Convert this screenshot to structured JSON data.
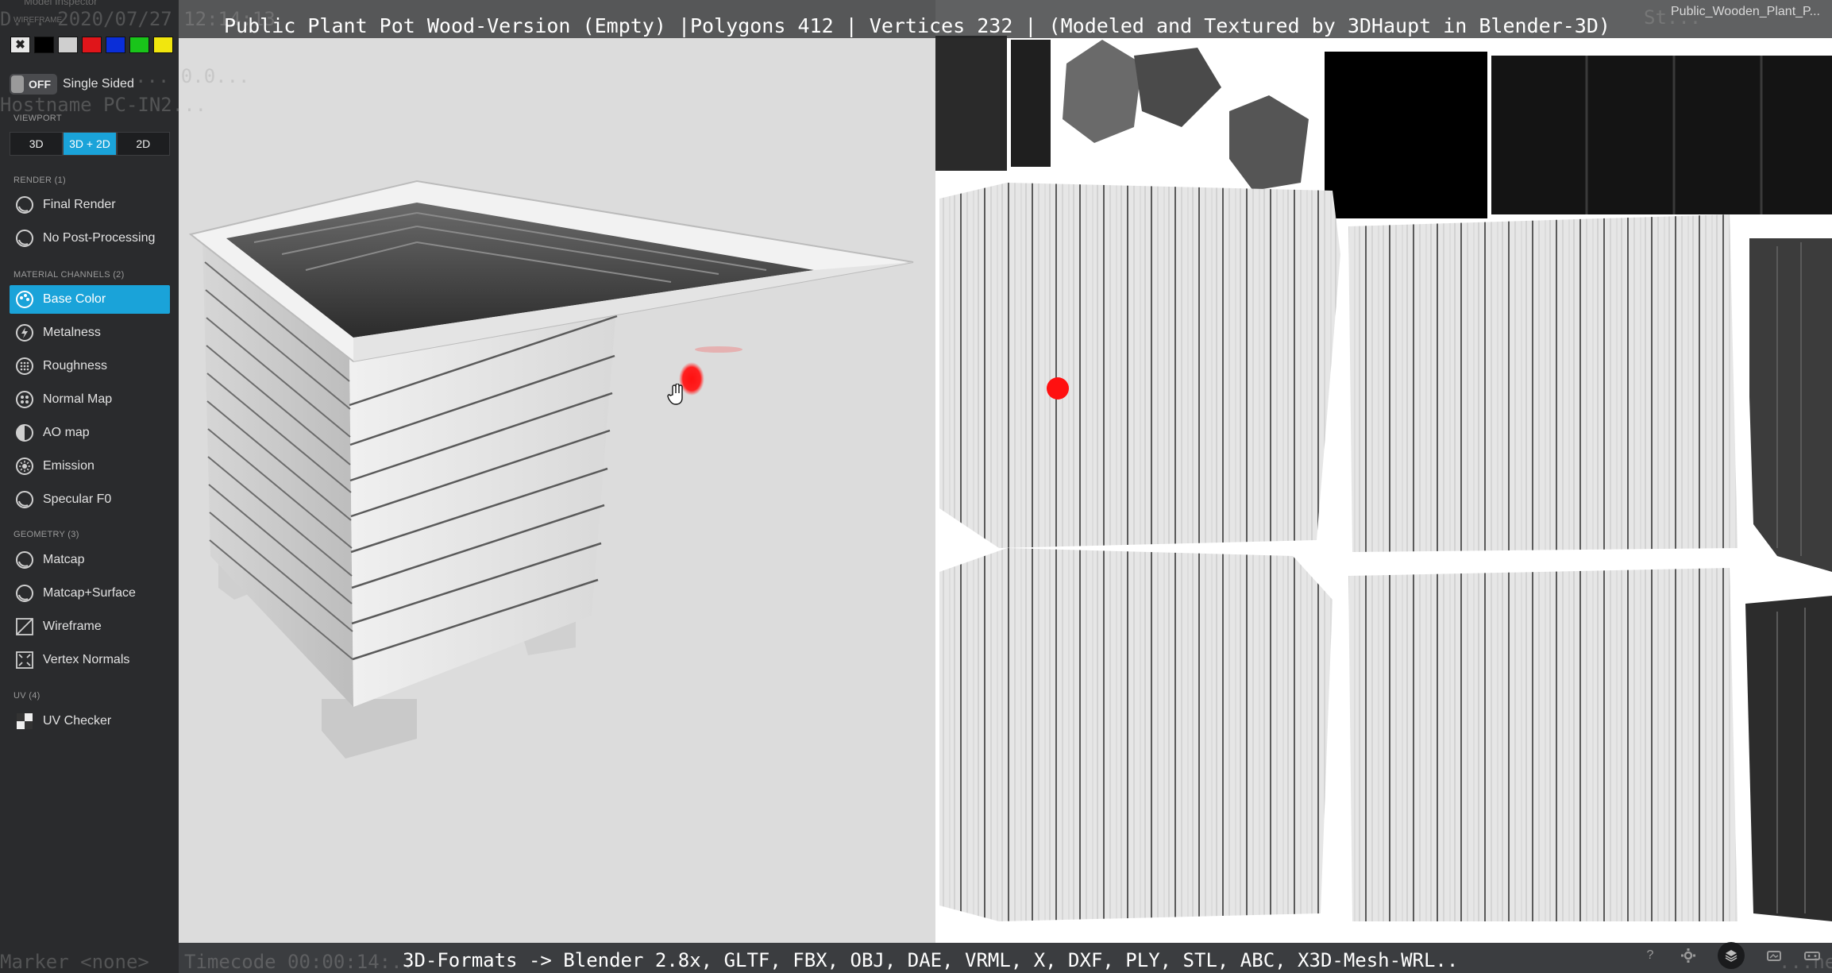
{
  "window": {
    "title": "Public Plant Pot Wood-Version (Empty) |Polygons 412 | Vertices 232 | (Modeled and Textured by 3DHaupt in Blender-3D)",
    "model_name": "Public_Wooden_Plant_P...",
    "formats": "3D-Formats -> Blender 2.8x, GLTF, FBX, OBJ, DAE, VRML, X, DXF, PLY, STL, ABC, X3D-Mesh-WRL.."
  },
  "sidebar": {
    "header": "Model Inspector",
    "wireframe_label": "WIREFRAME",
    "swatch_colors": [
      "#e8e8e8",
      "#000000",
      "#cfcfcf",
      "#e0151a",
      "#0a2ed8",
      "#19c41a",
      "#f1e60e"
    ],
    "swatch_selected_mark": "✖",
    "toggle": {
      "state": "OFF",
      "label": "Single Sided"
    },
    "viewport": {
      "section": "VIEWPORT",
      "buttons": [
        "3D",
        "3D + 2D",
        "2D"
      ],
      "active": "3D + 2D"
    },
    "render": {
      "section": "RENDER (1)",
      "items": [
        {
          "label": "Final Render",
          "icon": "sphere-icon"
        },
        {
          "label": "No Post-Processing",
          "icon": "sphere-icon"
        }
      ]
    },
    "material": {
      "section": "MATERIAL CHANNELS (2)",
      "items": [
        {
          "label": "Base Color",
          "icon": "palette-icon",
          "active": true
        },
        {
          "label": "Metalness",
          "icon": "lightning-icon"
        },
        {
          "label": "Roughness",
          "icon": "dots-sphere-icon"
        },
        {
          "label": "Normal Map",
          "icon": "bumps-sphere-icon"
        },
        {
          "label": "AO map",
          "icon": "half-sphere-icon"
        },
        {
          "label": "Emission",
          "icon": "sun-icon"
        },
        {
          "label": "Specular F0",
          "icon": "sphere-icon"
        }
      ]
    },
    "geometry": {
      "section": "GEOMETRY (3)",
      "items": [
        {
          "label": "Matcap",
          "icon": "sphere-icon"
        },
        {
          "label": "Matcap+Surface",
          "icon": "sphere-icon"
        },
        {
          "label": "Wireframe",
          "icon": "wireframe-icon"
        },
        {
          "label": "Vertex Normals",
          "icon": "vertex-normals-icon"
        }
      ]
    },
    "uv": {
      "section": "UV (4)",
      "items": [
        {
          "label": "UV Checker",
          "icon": "checker-icon"
        }
      ]
    }
  },
  "overlay_ghost": {
    "timestamp": "D... 2020/07/27 12:14:13",
    "line2": "... 0.0...",
    "hostname": "Hostname PC-IN2...",
    "marker": "Marker <none>",
    "timecode": "Timecode 00:00:14:..",
    "right_bottom": "...ne",
    "right_top": "St..."
  },
  "colors": {
    "accent": "#1aa3d9",
    "sidebar_bg": "#2a2b2d",
    "viewport3d_bg": "#dcdcdc",
    "marker_red": "#ff1010"
  },
  "bottom_icons": [
    "help-icon",
    "settings-icon",
    "layers-icon",
    "screenshot-icon",
    "vr-icon"
  ]
}
